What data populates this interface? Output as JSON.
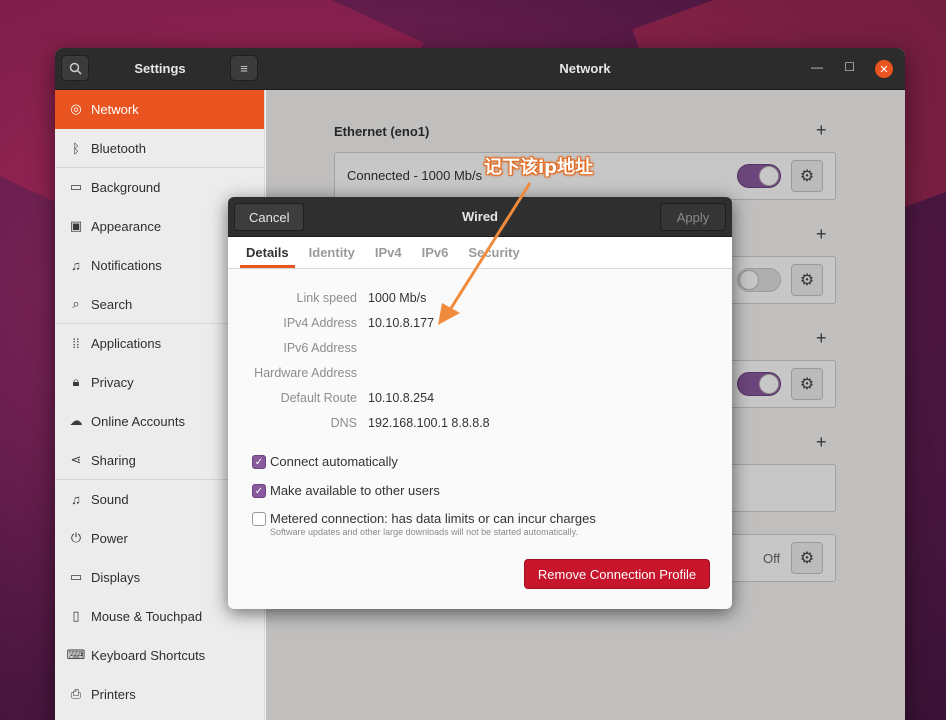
{
  "window": {
    "left_title": "Settings",
    "main_title": "Network"
  },
  "sidebar": {
    "items": [
      {
        "label": "Network",
        "icon": "network-icon"
      },
      {
        "label": "Bluetooth",
        "icon": "bluetooth-icon"
      },
      {
        "label": "Background",
        "icon": "background-icon"
      },
      {
        "label": "Appearance",
        "icon": "appearance-icon"
      },
      {
        "label": "Notifications",
        "icon": "bell-icon"
      },
      {
        "label": "Search",
        "icon": "search-icon"
      },
      {
        "label": "Applications",
        "icon": "grid-icon"
      },
      {
        "label": "Privacy",
        "icon": "lock-icon"
      },
      {
        "label": "Online Accounts",
        "icon": "cloud-icon"
      },
      {
        "label": "Sharing",
        "icon": "share-icon"
      },
      {
        "label": "Sound",
        "icon": "music-note-icon"
      },
      {
        "label": "Power",
        "icon": "power-icon"
      },
      {
        "label": "Displays",
        "icon": "display-icon"
      },
      {
        "label": "Mouse & Touchpad",
        "icon": "mouse-icon"
      },
      {
        "label": "Keyboard Shortcuts",
        "icon": "keyboard-icon"
      },
      {
        "label": "Printers",
        "icon": "printer-icon"
      }
    ]
  },
  "main": {
    "ethernet_title": "Ethernet (eno1)",
    "ethernet_status": "Connected - 1000 Mb/s",
    "proxy_status": "Off"
  },
  "dialog": {
    "cancel": "Cancel",
    "title": "Wired",
    "apply": "Apply",
    "tabs": [
      "Details",
      "Identity",
      "IPv4",
      "IPv6",
      "Security"
    ],
    "details": [
      {
        "label": "Link speed",
        "value": "1000 Mb/s"
      },
      {
        "label": "IPv4 Address",
        "value": "10.10.8.177"
      },
      {
        "label": "IPv6 Address",
        "value": ""
      },
      {
        "label": "Hardware Address",
        "value": ""
      },
      {
        "label": "Default Route",
        "value": "10.10.8.254"
      },
      {
        "label": "DNS",
        "value": "192.168.100.1 8.8.8.8"
      }
    ],
    "checks": {
      "connect_auto": "Connect automatically",
      "available_users": "Make available to other users",
      "metered": "Metered connection: has data limits or can incur charges",
      "metered_sub": "Software updates and other large downloads will not be started automatically."
    },
    "remove": "Remove Connection Profile"
  },
  "annotation": {
    "text": "记下该ip地址"
  },
  "colors": {
    "accent": "#e95420",
    "toggle_on": "#8a5a9e",
    "danger": "#c7162b"
  }
}
